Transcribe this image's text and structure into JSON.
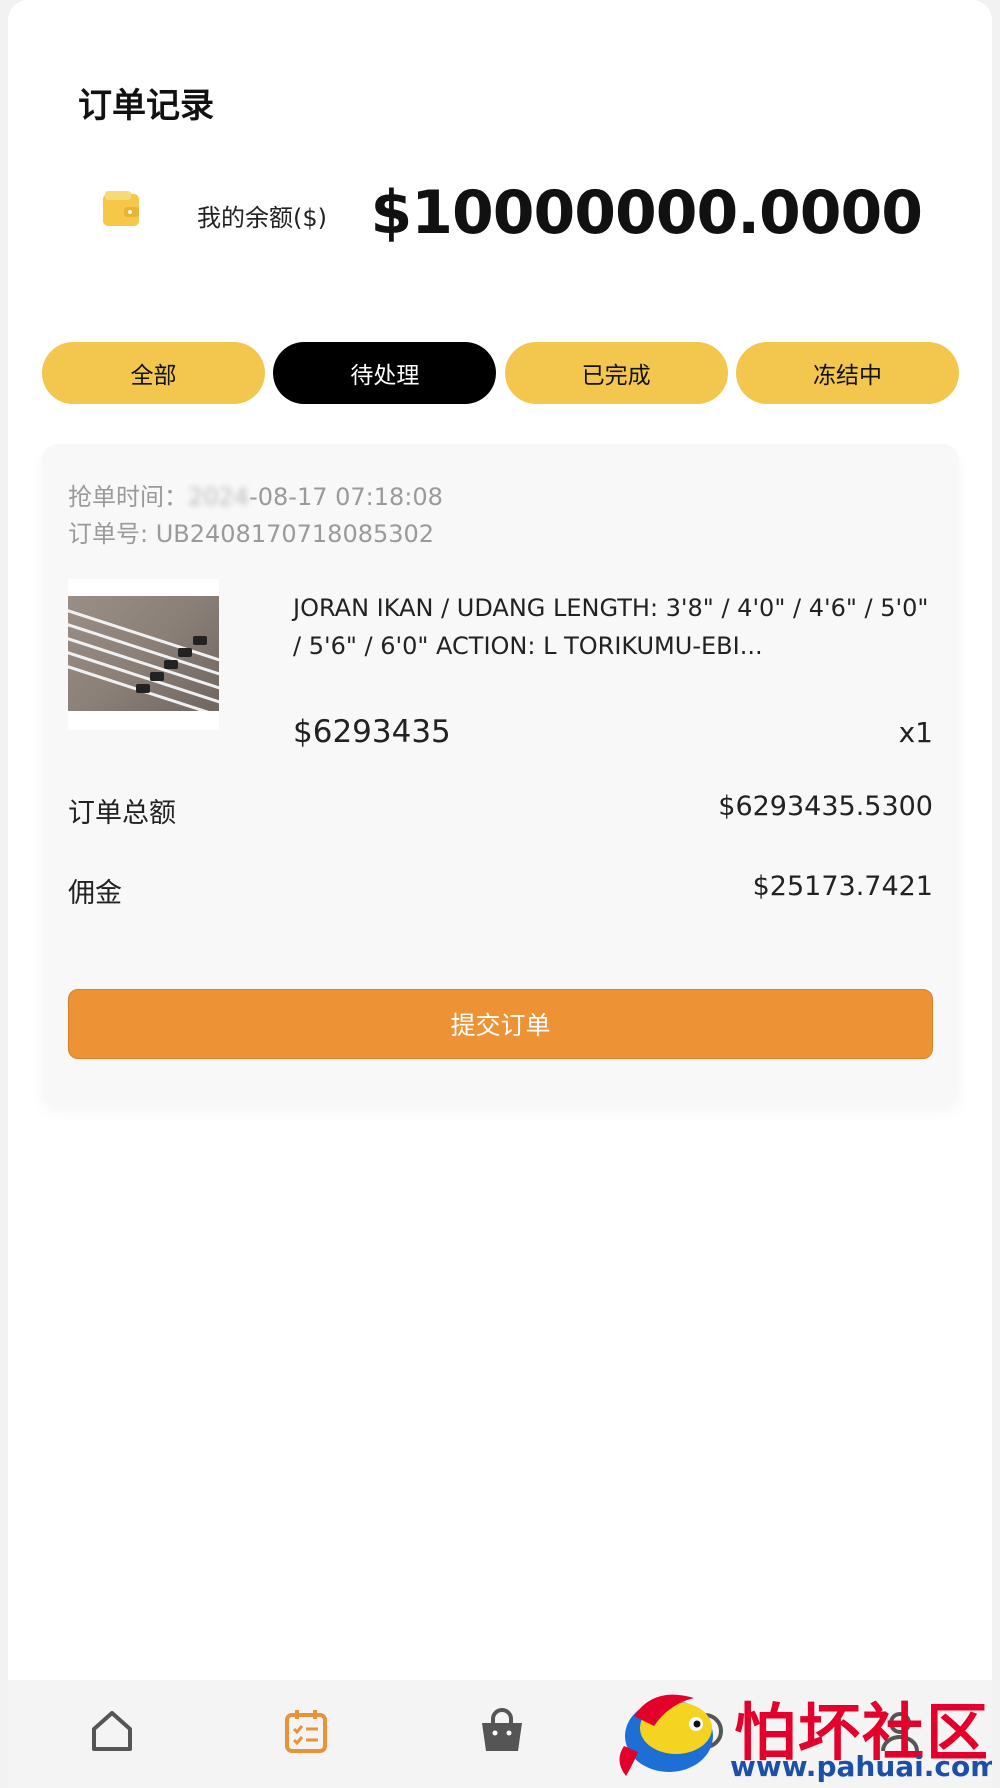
{
  "page": {
    "title": "订单记录"
  },
  "balance": {
    "icon": "wallet-icon",
    "label": "我的余额($)",
    "value": "$10000000.0000"
  },
  "tabs": [
    {
      "label": "全部",
      "active": false
    },
    {
      "label": "待处理",
      "active": true
    },
    {
      "label": "已完成",
      "active": false
    },
    {
      "label": "冻结中",
      "active": false
    }
  ],
  "order": {
    "time_label": "抢单时间：",
    "time_value_obscured": "2024",
    "time_value": "-08-17 07:18:08",
    "order_no_label": "订单号: ",
    "order_no": "UB2408170718085302",
    "product_name": "JORAN IKAN / UDANG LENGTH: 3'8\" / 4'0\" / 4'6\" / 5'0\" / 5'6\" / 6'0\" ACTION: L TORIKUMU-EBI...",
    "product_price": "$6293435",
    "quantity": "x1",
    "total_label": "订单总额",
    "total_value": "$6293435.5300",
    "commission_label": "佣金",
    "commission_value": "$25173.7421",
    "submit_label": "提交订单"
  },
  "nav": [
    {
      "icon": "home-icon",
      "active": false
    },
    {
      "icon": "orders-icon",
      "active": true
    },
    {
      "icon": "shop-bag-icon",
      "active": false
    },
    {
      "icon": "service-icon",
      "active": false
    },
    {
      "icon": "user-icon",
      "active": false
    }
  ],
  "watermark": {
    "title": "怕坏社区",
    "url": "www.pahuai.com"
  },
  "colors": {
    "tab": "#f3c74d",
    "tab_active": "#000000",
    "submit": "#ee9236",
    "accent_nav": "#e8923a",
    "watermark_red": "#e3002b",
    "watermark_blue": "#1d4fa8"
  }
}
